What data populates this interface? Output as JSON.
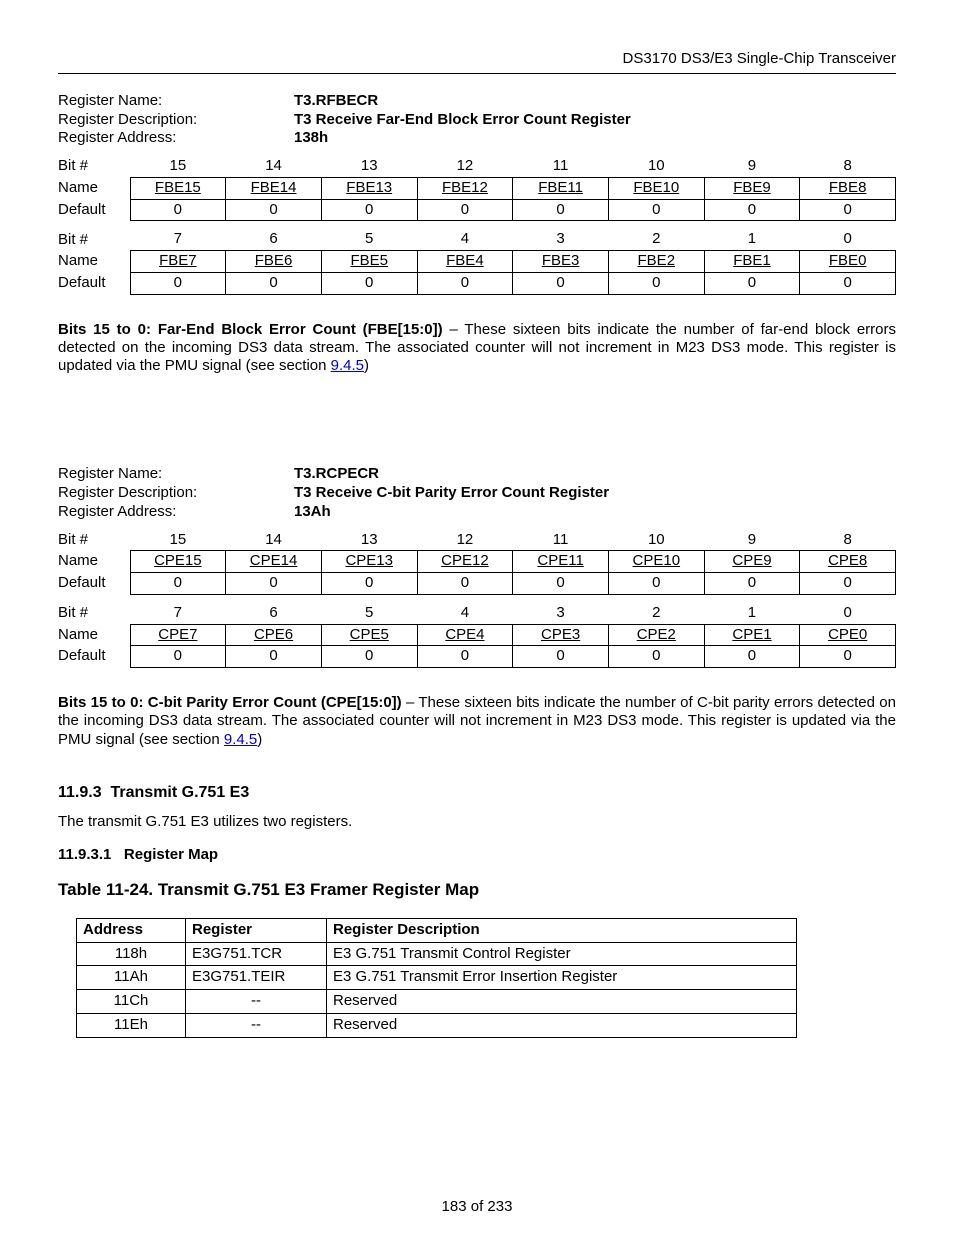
{
  "header": {
    "title": "DS3170 DS3/E3 Single-Chip Transceiver"
  },
  "labels": {
    "regName": "Register Name:",
    "regDesc": "Register Description:",
    "regAddr": "Register Address:",
    "bit": "Bit #",
    "name": "Name",
    "default": "Default"
  },
  "reg1": {
    "name": "T3.RFBECR",
    "desc": "T3 Receive Far-End Block Error Count Register",
    "addr": "138h",
    "rowHi": {
      "bits": [
        "15",
        "14",
        "13",
        "12",
        "11",
        "10",
        "9",
        "8"
      ],
      "names": [
        "FBE15",
        "FBE14",
        "FBE13",
        "FBE12",
        "FBE11",
        "FBE10",
        "FBE9",
        "FBE8"
      ],
      "def": [
        "0",
        "0",
        "0",
        "0",
        "0",
        "0",
        "0",
        "0"
      ]
    },
    "rowLo": {
      "bits": [
        "7",
        "6",
        "5",
        "4",
        "3",
        "2",
        "1",
        "0"
      ],
      "names": [
        "FBE7",
        "FBE6",
        "FBE5",
        "FBE4",
        "FBE3",
        "FBE2",
        "FBE1",
        "FBE0"
      ],
      "def": [
        "0",
        "0",
        "0",
        "0",
        "0",
        "0",
        "0",
        "0"
      ]
    },
    "para": {
      "lead": "Bits 15 to 0: Far-End Block Error Count (FBE[15:0])",
      "body": " – These sixteen bits indicate the number of far-end block errors detected on the incoming DS3 data stream. The associated counter will not increment in M23 DS3 mode. This register is updated via the PMU signal (see section ",
      "link": "9.4.5",
      "tail": ")"
    }
  },
  "reg2": {
    "name": "T3.RCPECR",
    "desc": "T3 Receive C-bit Parity Error Count Register",
    "addr": "13Ah",
    "rowHi": {
      "bits": [
        "15",
        "14",
        "13",
        "12",
        "11",
        "10",
        "9",
        "8"
      ],
      "names": [
        "CPE15",
        "CPE14",
        "CPE13",
        "CPE12",
        "CPE11",
        "CPE10",
        "CPE9",
        "CPE8"
      ],
      "def": [
        "0",
        "0",
        "0",
        "0",
        "0",
        "0",
        "0",
        "0"
      ]
    },
    "rowLo": {
      "bits": [
        "7",
        "6",
        "5",
        "4",
        "3",
        "2",
        "1",
        "0"
      ],
      "names": [
        "CPE7",
        "CPE6",
        "CPE5",
        "CPE4",
        "CPE3",
        "CPE2",
        "CPE1",
        "CPE0"
      ],
      "def": [
        "0",
        "0",
        "0",
        "0",
        "0",
        "0",
        "0",
        "0"
      ]
    },
    "para": {
      "lead": "Bits 15 to 0: C-bit Parity Error Count (CPE[15:0])",
      "body": " – These sixteen bits indicate the number of C-bit parity errors detected on the incoming DS3 data stream. The associated counter will not increment in M23 DS3 mode.  This register is updated via the PMU signal (see section ",
      "link": "9.4.5",
      "tail": ")"
    }
  },
  "section": {
    "num": "11.9.3",
    "title": "Transmit G.751 E3",
    "intro": "The transmit G.751 E3 utilizes two registers.",
    "subnum": "11.9.3.1",
    "subtitle": "Register Map",
    "tableTitle": "Table 11-24. Transmit G.751 E3 Framer Register Map",
    "headers": {
      "addr": "Address",
      "reg": "Register",
      "desc": "Register Description"
    },
    "rows": [
      {
        "addr": "118h",
        "reg": "E3G751.TCR",
        "desc": "E3 G.751 Transmit Control Register",
        "center": false
      },
      {
        "addr": "11Ah",
        "reg": "E3G751.TEIR",
        "desc": "E3 G.751 Transmit Error Insertion Register",
        "center": false
      },
      {
        "addr": "11Ch",
        "reg": "--",
        "desc": "Reserved",
        "center": true
      },
      {
        "addr": "11Eh",
        "reg": "--",
        "desc": "Reserved",
        "center": true
      }
    ]
  },
  "footer": {
    "page": "183 of 233"
  }
}
